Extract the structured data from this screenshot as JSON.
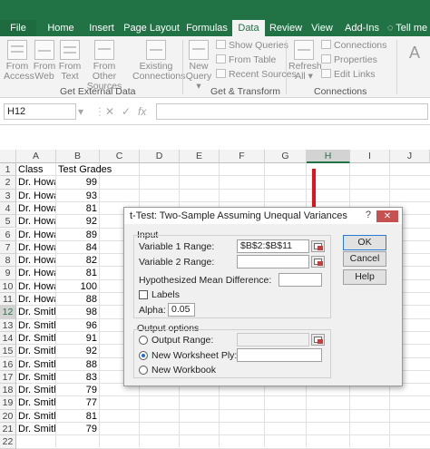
{
  "ribbon_tabs": [
    "File",
    "Home",
    "Insert",
    "Page Layout",
    "Formulas",
    "Data",
    "Review",
    "View",
    "Add-Ins",
    "Tell me"
  ],
  "active_tab": "Data",
  "ribbon": {
    "get_external_data": {
      "buttons": [
        {
          "line1": "From",
          "line2": "Access"
        },
        {
          "line1": "From",
          "line2": "Web"
        },
        {
          "line1": "From",
          "line2": "Text"
        },
        {
          "line1": "From Other",
          "line2": "Sources"
        },
        {
          "line1": "Existing",
          "line2": "Connections"
        }
      ],
      "label": "Get External Data"
    },
    "get_transform": {
      "new_query": {
        "line1": "New",
        "line2": "Query"
      },
      "items": [
        "Show Queries",
        "From Table",
        "Recent Sources"
      ],
      "label": "Get & Transform"
    },
    "connections": {
      "refresh": {
        "line1": "Refresh",
        "line2": "All"
      },
      "items": [
        "Connections",
        "Properties",
        "Edit Links"
      ],
      "label": "Connections"
    },
    "extra_letter": "A"
  },
  "formula_bar": {
    "name_box": "H12",
    "cancel": "✕",
    "enter": "✓",
    "fx": "fx"
  },
  "grid": {
    "columns": [
      "A",
      "B",
      "C",
      "D",
      "E",
      "F",
      "G",
      "H",
      "I",
      "J"
    ],
    "selected_column": "H",
    "selected_row": "12",
    "rows": [
      {
        "n": "1",
        "a": "Class",
        "b": "Test Grades"
      },
      {
        "n": "2",
        "a": "Dr. Howar",
        "b": "99"
      },
      {
        "n": "3",
        "a": "Dr. Howar",
        "b": "93"
      },
      {
        "n": "4",
        "a": "Dr. Howar",
        "b": "81"
      },
      {
        "n": "5",
        "a": "Dr. Howar",
        "b": "92"
      },
      {
        "n": "6",
        "a": "Dr. Howar",
        "b": "89"
      },
      {
        "n": "7",
        "a": "Dr. Howar",
        "b": "84"
      },
      {
        "n": "8",
        "a": "Dr. Howar",
        "b": "82"
      },
      {
        "n": "9",
        "a": "Dr. Howar",
        "b": "81"
      },
      {
        "n": "10",
        "a": "Dr. Howar",
        "b": "100"
      },
      {
        "n": "11",
        "a": "Dr. Howar",
        "b": "88"
      },
      {
        "n": "12",
        "a": "Dr. Smith",
        "b": "98"
      },
      {
        "n": "13",
        "a": "Dr. Smith",
        "b": "96"
      },
      {
        "n": "14",
        "a": "Dr. Smith",
        "b": "91"
      },
      {
        "n": "15",
        "a": "Dr. Smith",
        "b": "92"
      },
      {
        "n": "16",
        "a": "Dr. Smith",
        "b": "88"
      },
      {
        "n": "17",
        "a": "Dr. Smith",
        "b": "83"
      },
      {
        "n": "18",
        "a": "Dr. Smith",
        "b": "79"
      },
      {
        "n": "19",
        "a": "Dr. Smith",
        "b": "77"
      },
      {
        "n": "20",
        "a": "Dr. Smith",
        "b": "81"
      },
      {
        "n": "21",
        "a": "Dr. Smith",
        "b": "79"
      },
      {
        "n": "22",
        "a": "",
        "b": ""
      }
    ]
  },
  "dialog": {
    "title": "t-Test: Two-Sample Assuming Unequal Variances",
    "help_glyph": "?",
    "close_glyph": "✕",
    "input_section": "Input",
    "variable1_label": "Variable 1 Range:",
    "variable1_value": "$B$2:$B$11",
    "variable2_label": "Variable 2 Range:",
    "variable2_value": "",
    "hyp_label": "Hypothesized Mean Difference:",
    "labels_checkbox": "Labels",
    "alpha_label": "Alpha:",
    "alpha_value": "0.05",
    "output_section": "Output options",
    "output_range": "Output Range:",
    "new_ply": "New Worksheet Ply:",
    "new_workbook": "New Workbook",
    "ok": "OK",
    "cancel": "Cancel",
    "help": "Help"
  }
}
